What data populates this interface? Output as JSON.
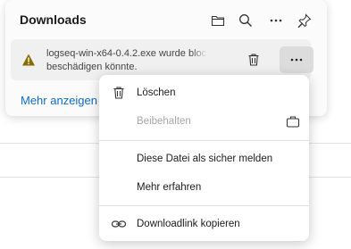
{
  "panel": {
    "title": "Downloads",
    "header_icons": [
      "folder-icon",
      "search-icon",
      "more-horizontal-icon",
      "pin-icon"
    ],
    "download": {
      "status_icon": "warning-icon",
      "line1": "logseq-win-x64-0.4.2.exe wurde blockiert",
      "line2": "beschädigen könnte.",
      "delete_icon": "trash-icon",
      "more_label": "..."
    },
    "more_link": "Mehr anzeigen"
  },
  "menu": {
    "items": [
      {
        "label": "Löschen",
        "icon": "trash-icon",
        "enabled": true
      },
      {
        "label": "Beibehalten",
        "icon": "briefcase-icon",
        "enabled": false
      },
      {
        "label": "Diese Datei als sicher melden",
        "enabled": true
      },
      {
        "label": "Mehr erfahren",
        "enabled": true
      },
      {
        "label": "Downloadlink kopieren",
        "icon": "link-icon",
        "enabled": true
      }
    ]
  },
  "colors": {
    "accent": "#0f6cbd",
    "warning": "#8a6d00",
    "disabled_text": "#a6a6a6"
  }
}
